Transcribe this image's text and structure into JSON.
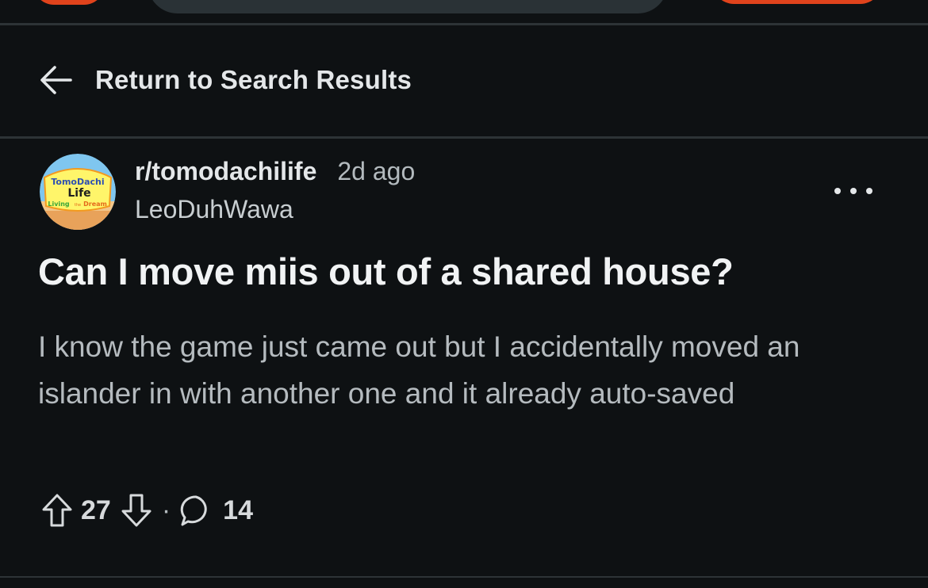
{
  "top_bar": {
    "left_button": "",
    "search": "",
    "right_button": ""
  },
  "navigation": {
    "back_label": "Return to Search Results",
    "back_icon": "arrow-left-icon"
  },
  "post": {
    "avatar_logo_text": {
      "line1": "TomoDachi",
      "line2": "Life",
      "line3": "Living the Dream"
    },
    "subreddit": "r/tomodachilife",
    "time_ago": "2d ago",
    "author": "LeoDuhWawa",
    "more_icon": "more-horizontal-icon",
    "title": "Can I move miis out of a shared house?",
    "body": "I know the game just came out but I accidentally moved an islander in with another one and it already auto-saved",
    "upvote_icon": "upvote-arrow-icon",
    "vote_count": "27",
    "downvote_icon": "downvote-arrow-icon",
    "separator": "·",
    "comment_icon": "comment-bubble-icon",
    "comment_count": "14"
  },
  "colors": {
    "background": "#0e1113",
    "accent": "#e0431c",
    "text_primary": "#e4e7e9",
    "text_secondary": "#b5bbbf"
  }
}
